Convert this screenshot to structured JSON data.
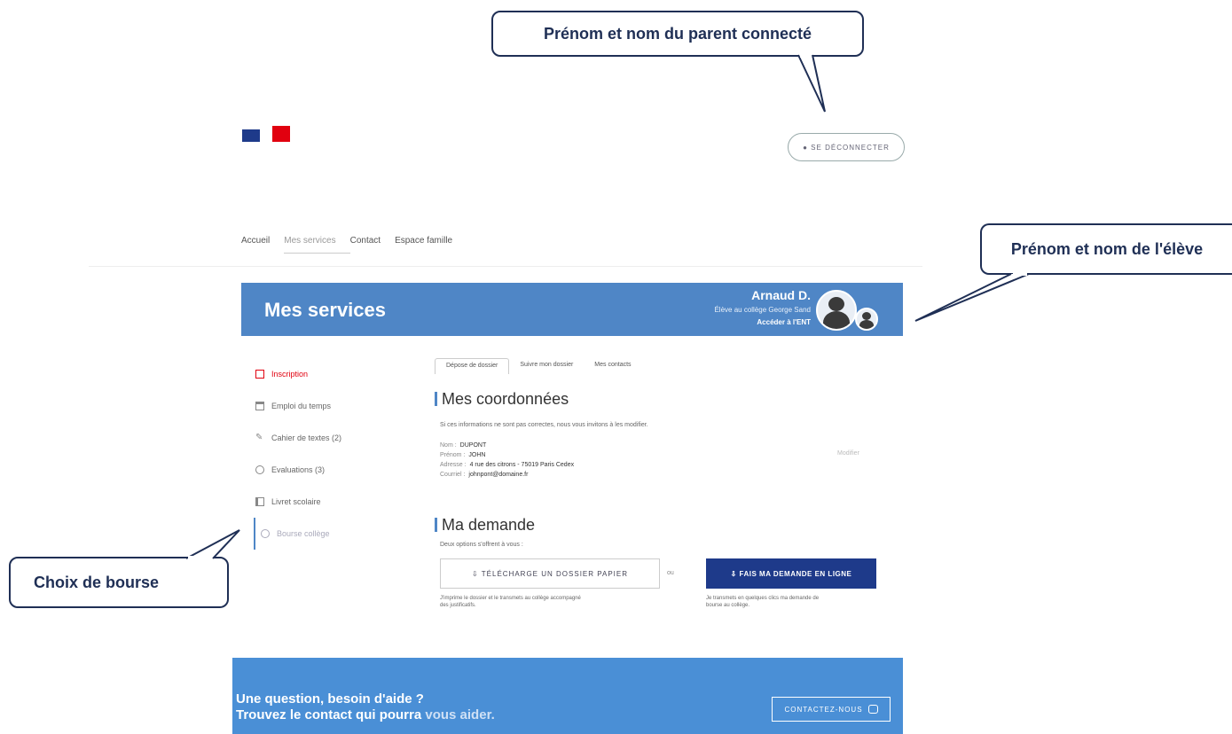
{
  "callouts": {
    "parent": "Prénom et nom du parent connecté",
    "student": "Prénom et nom de l'élève",
    "scholarship": "Choix de bourse"
  },
  "header": {
    "logout_label": "● SE DÉCONNECTER"
  },
  "nav": {
    "items": [
      "Accueil",
      "Mes services",
      "Contact",
      "Espace famille"
    ]
  },
  "banner": {
    "title": "Mes services",
    "student_name": "Arnaud D.",
    "student_school": "Élève au collège George Sand",
    "student_link": "Accéder à l'ENT"
  },
  "sidebar": {
    "items": [
      "Inscription",
      "Emploi du temps",
      "Cahier de textes (2)",
      "Evaluations (3)",
      "Livret scolaire",
      "Bourse collège"
    ]
  },
  "tabs": [
    "Dépose de dossier",
    "Suivre mon dossier",
    "Mes contacts"
  ],
  "coordonnees": {
    "title": "Mes coordonnées",
    "intro": "Si ces informations ne sont pas correctes, nous vous invitons à les modifier.",
    "rows": [
      {
        "label": "Nom :",
        "value": "DUPONT"
      },
      {
        "label": "Prénom :",
        "value": "JOHN"
      },
      {
        "label": "Adresse :",
        "value": "4 rue des citrons - 75019 Paris Cedex"
      },
      {
        "label": "Courriel :",
        "value": "johnpont@domaine.fr"
      }
    ],
    "edit_label": "Modifier"
  },
  "demande": {
    "title": "Ma demande",
    "intro": "Deux options s'offrent à vous :",
    "download_label": "⇩ TÉLÉCHARGE UN DOSSIER PAPIER",
    "or_label": "ou",
    "online_label": "⇩ FAIS MA DEMANDE EN LIGNE",
    "download_help_1": "J'imprime le dossier et le transmets au collège accompagné",
    "download_help_2": "des justificatifs.",
    "online_help_1": "Je transmets en quelques clics ma demande de",
    "online_help_2": "bourse au collège."
  },
  "footer": {
    "line1": "Une question, besoin d'aide ?",
    "line2_a": "Trouvez le contact qui pourra ",
    "line2_b": "vous aider.",
    "contact_label": "CONTACTEZ-NOUS"
  }
}
